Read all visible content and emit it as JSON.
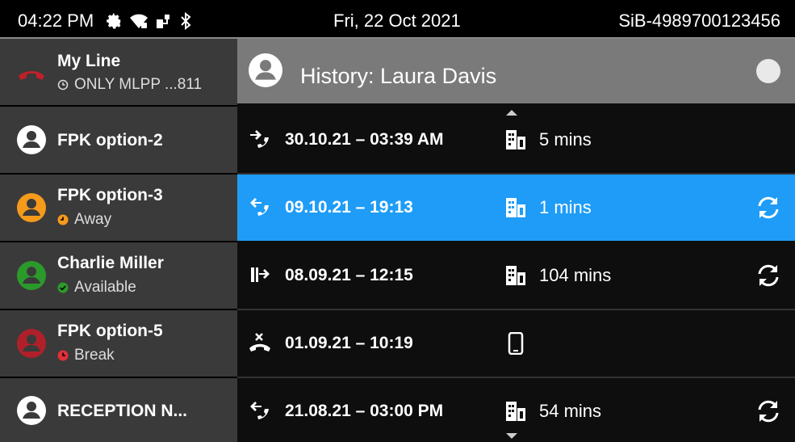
{
  "status_bar": {
    "time": "04:22 PM",
    "icons": [
      "gear-icon",
      "wifi-icon",
      "network-icon",
      "bluetooth-icon"
    ],
    "date": "Fri, 22 Oct 2021",
    "number": "SiB-4989700123456"
  },
  "lines": [
    {
      "name": "My Line",
      "status": "ONLY MLPP ...811",
      "icon": "handset-icon",
      "status_icon": "clock-icon",
      "color": "#c0202a"
    },
    {
      "name": "FPK option-2",
      "status": "",
      "icon": "avatar-icon",
      "color": "#ffffff"
    },
    {
      "name": "FPK option-3",
      "status": "Away",
      "icon": "avatar-icon",
      "status_icon": "away-icon",
      "color": "#f59a1b"
    },
    {
      "name": "Charlie Miller",
      "status": "Available",
      "icon": "avatar-icon",
      "status_icon": "available-icon",
      "color": "#2b9a2b"
    },
    {
      "name": "FPK option-5",
      "status": "Break",
      "icon": "avatar-icon",
      "status_icon": "break-icon",
      "color": "#b0202a"
    },
    {
      "name": "RECEPTION N...",
      "status": "",
      "icon": "avatar-icon",
      "color": "#ffffff"
    }
  ],
  "history": {
    "title": "History: Laura Davis",
    "entries": [
      {
        "call_icon": "incoming-forwarded-icon",
        "datetime": "30.10.21 – 03:39 AM",
        "device_icon": "building-icon",
        "duration": "5 mins",
        "sync": false,
        "selected": false
      },
      {
        "call_icon": "outgoing-forwarded-icon",
        "datetime": "09.10.21 – 19:13",
        "device_icon": "building-icon",
        "duration": "1 mins",
        "sync": true,
        "selected": true
      },
      {
        "call_icon": "transferred-icon",
        "datetime": "08.09.21 – 12:15",
        "device_icon": "building-icon",
        "duration": "104 mins",
        "sync": true,
        "selected": false
      },
      {
        "call_icon": "missed-call-icon",
        "datetime": "01.09.21 – 10:19",
        "device_icon": "mobile-icon",
        "duration": "",
        "sync": false,
        "selected": false
      },
      {
        "call_icon": "outgoing-forwarded-icon",
        "datetime": "21.08.21 – 03:00 PM",
        "device_icon": "building-icon",
        "duration": "54 mins",
        "sync": true,
        "selected": false
      }
    ]
  },
  "colors": {
    "selected": "#1e9cf7",
    "left_bg": "#3a3a3a",
    "header_bg": "#7a7a7a"
  }
}
